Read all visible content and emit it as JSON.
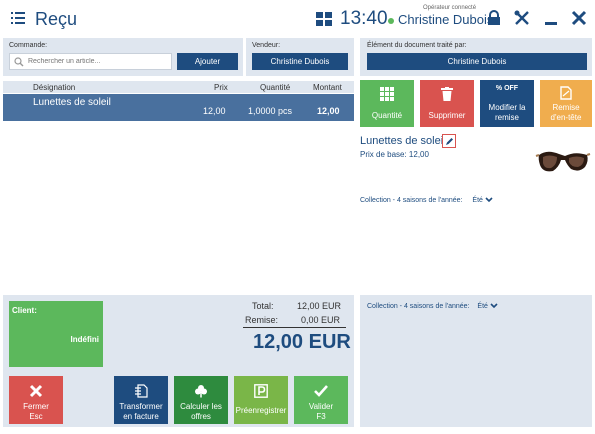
{
  "header": {
    "title": "Reçu",
    "clock": "13:40",
    "operator_caption": "Opérateur connecté",
    "operator_name": "Christine Dubois"
  },
  "command": {
    "label": "Commande:",
    "search_placeholder": "Rechercher un article...",
    "add_label": "Ajouter"
  },
  "seller": {
    "label": "Vendeur:",
    "name": "Christine Dubois"
  },
  "processed_by": {
    "label": "Élément du document traité par:",
    "name": "Christine Dubois"
  },
  "table": {
    "headers": {
      "designation": "Désignation",
      "price": "Prix",
      "quantity": "Quantité",
      "amount": "Montant"
    },
    "rows": [
      {
        "designation": "Lunettes de soleil",
        "price": "12,00",
        "quantity": "1,0000 pcs",
        "amount": "12,00"
      }
    ]
  },
  "actions": {
    "quantity": "Quantité",
    "delete": "Supprimer",
    "modify_discount_badge": "% OFF",
    "modify_discount": "Modifier la remise",
    "header_discount": "Remise d'en-tête"
  },
  "item": {
    "name": "Lunettes de soleil",
    "base_price": "Prix de base: 12,00",
    "collection_label": "Collection - 4 saisons de l'année:",
    "collection_value": "Été"
  },
  "client": {
    "label": "Client:",
    "value": "Indéfini"
  },
  "totals": {
    "total_label": "Total:",
    "total_value": "12,00 EUR",
    "discount_label": "Remise:",
    "discount_value": "0,00 EUR",
    "grand_total": "12,00 EUR"
  },
  "doc_collection": {
    "label": "Collection - 4 saisons de l'année:",
    "value": "Été"
  },
  "bottom_buttons": {
    "close": "Fermer",
    "close_key": "Esc",
    "invoice_1": "Transformer",
    "invoice_2": "en facture",
    "offers_1": "Calculer les",
    "offers_2": "offres",
    "preregister": "Préenregistrer",
    "validate": "Valider",
    "validate_key": "F3"
  },
  "colors": {
    "brand": "#1e4c7f",
    "selected_row": "#49709e",
    "panel": "#dfe6ef",
    "green": "#5cb85c",
    "red": "#d9534f",
    "orange": "#f0ad4e",
    "dark_green": "#2e8b3e",
    "olive_green": "#7ab648"
  }
}
